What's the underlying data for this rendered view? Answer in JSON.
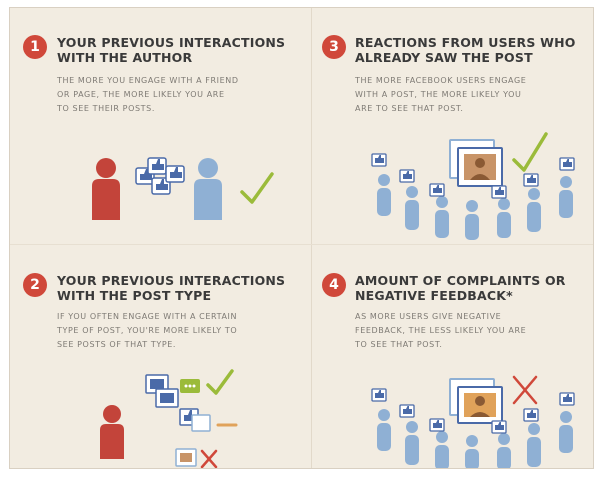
{
  "colors": {
    "accent_red": "#d0483a",
    "person_blue": "#8fb0d4",
    "person_red": "#c3443a",
    "check_green": "#9bbb3a",
    "like_blue": "#4a6aa8",
    "title_text": "#3a3a3a",
    "body_text": "#7e7a74",
    "background": "#f2ece1"
  },
  "sections": [
    {
      "number": "1",
      "title_line1": "YOUR PREVIOUS INTERACTIONS",
      "title_line2": "WITH THE AUTHOR",
      "body_line1": "THE MORE YOU ENGAGE WITH A FRIEND",
      "body_line2": "OR PAGE, THE MORE LIKELY YOU ARE",
      "body_line3": "TO SEE THEIR POSTS.",
      "icons": [
        "red-person-icon",
        "like-thumbs-icon",
        "blue-person-icon",
        "checkmark-icon"
      ]
    },
    {
      "number": "2",
      "title_line1": "YOUR PREVIOUS INTERACTIONS",
      "title_line2": "WITH THE POST TYPE",
      "body_line1": "IF YOU OFTEN ENGAGE WITH A CERTAIN",
      "body_line2": "TYPE OF POST, YOU'RE MORE LIKELY TO",
      "body_line3": "SEE POSTS OF THAT TYPE.",
      "icons": [
        "red-person-icon",
        "photo-post-icon",
        "chat-post-icon",
        "like-post-icon",
        "checkmark-icon",
        "dash-icon",
        "cross-icon"
      ]
    },
    {
      "number": "3",
      "title_line1": "REACTIONS FROM USERS WHO",
      "title_line2": "ALREADY SAW THE POST",
      "body_line1": "THE MORE FACEBOOK USERS ENGAGE",
      "body_line2": "WITH A POST, THE MORE LIKELY YOU",
      "body_line3": "ARE TO SEE THAT POST.",
      "icons": [
        "photo-post-icon",
        "crowd-of-users-icon",
        "like-thumbs-icon",
        "checkmark-icon"
      ]
    },
    {
      "number": "4",
      "title_line1": "AMOUNT OF COMPLAINTS OR",
      "title_line2": "NEGATIVE FEEDBACK*",
      "body_line1": "AS MORE USERS GIVE NEGATIVE",
      "body_line2": "FEEDBACK, THE LESS LIKELY YOU ARE",
      "body_line3": "TO SEE THAT POST.",
      "icons": [
        "photo-post-icon",
        "crowd-of-users-icon",
        "like-thumbs-icon",
        "cross-icon"
      ]
    }
  ]
}
